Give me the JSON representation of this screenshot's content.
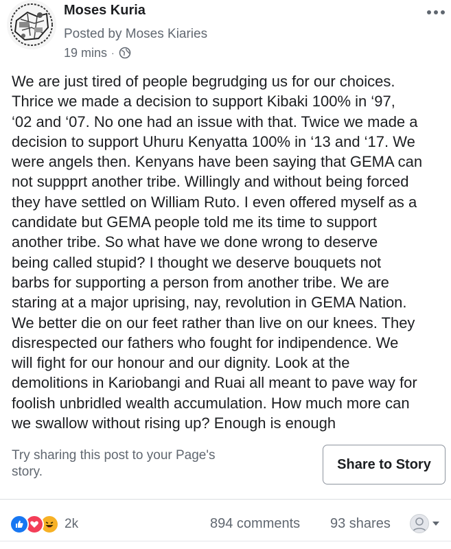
{
  "post": {
    "author": "Moses Kuria",
    "posted_by": "Posted by Moses Kiaries",
    "time": "19 mins",
    "separator": "·",
    "privacy_icon": "globe-icon",
    "menu_icon": "more-horizontal-icon",
    "body_lines": [
      "We are just tired of people begrudging us for our choices.",
      "Thrice we made a decision to support Kibaki 100% in ‘97,",
      "‘02 and ‘07. No one had an issue with that. Twice we made a",
      "decision to support Uhuru Kenyatta 100% in ‘13 and ‘17. We",
      "were angels then. Kenyans have been saying that GEMA can",
      "not suppprt another tribe. Willingly and without being forced",
      "they have settled on William Ruto. I even offered myself as a",
      "candidate but GEMA people told me its time to support",
      "another tribe. So what have we done wrong to deserve",
      "being called stupid? I thought we deserve bouquets not",
      "barbs for supporting a person from another tribe. We are",
      "staring at a major uprising, nay, revolution in GEMA Nation.",
      "We better die on our feet rather than live on our knees. They",
      "disrespected our fathers who fought for indipendence. We",
      "will fight for our honour and our dignity. Look at the",
      "demolitions in Kariobangi and Ruai all meant to pave way for",
      "foolish unbridled wealth accumulation. How much more can",
      "we swallow without rising up? Enough is enough"
    ]
  },
  "share": {
    "prompt_lines": [
      "Try sharing this post to your Page's",
      "story."
    ],
    "button_label": "Share to Story"
  },
  "engagement": {
    "reactions": [
      "like",
      "love",
      "haha"
    ],
    "reaction_count": "2k",
    "comments": "894 comments",
    "shares": "93 shares"
  },
  "colors": {
    "like": "#1877f2",
    "love": "#f33e58",
    "haha": "#f7b125",
    "text_secondary": "#606770"
  }
}
